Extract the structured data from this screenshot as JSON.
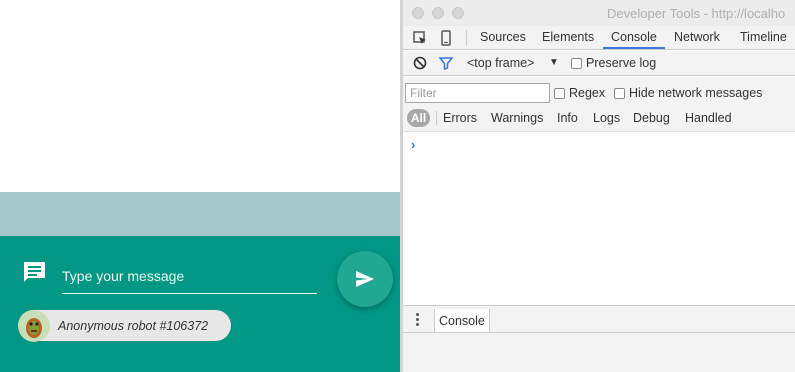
{
  "app": {
    "message_placeholder": "Type your message",
    "user_name": "Anonymous robot #106372",
    "colors": {
      "teal": "#009784",
      "strip": "#a3c6ca",
      "send_button": "#20a892",
      "chip": "#e7e7e7"
    }
  },
  "devtools": {
    "window_title": "Developer Tools - http://localho",
    "tabs": [
      {
        "label": "Sources",
        "active": false
      },
      {
        "label": "Elements",
        "active": false
      },
      {
        "label": "Console",
        "active": true
      },
      {
        "label": "Network",
        "active": false
      },
      {
        "label": "Timeline",
        "active": false
      }
    ],
    "frame_select": "<top frame>",
    "preserve_log_label": "Preserve log",
    "filter_placeholder": "Filter",
    "regex_label": "Regex",
    "hide_network_label": "Hide network messages",
    "levels": [
      "All",
      "Errors",
      "Warnings",
      "Info",
      "Logs",
      "Debug",
      "Handled"
    ],
    "prompt_symbol": "›",
    "drawer_tab": "Console",
    "colors": {
      "accent": "#3879d9",
      "prompt": "#367cf1"
    }
  }
}
